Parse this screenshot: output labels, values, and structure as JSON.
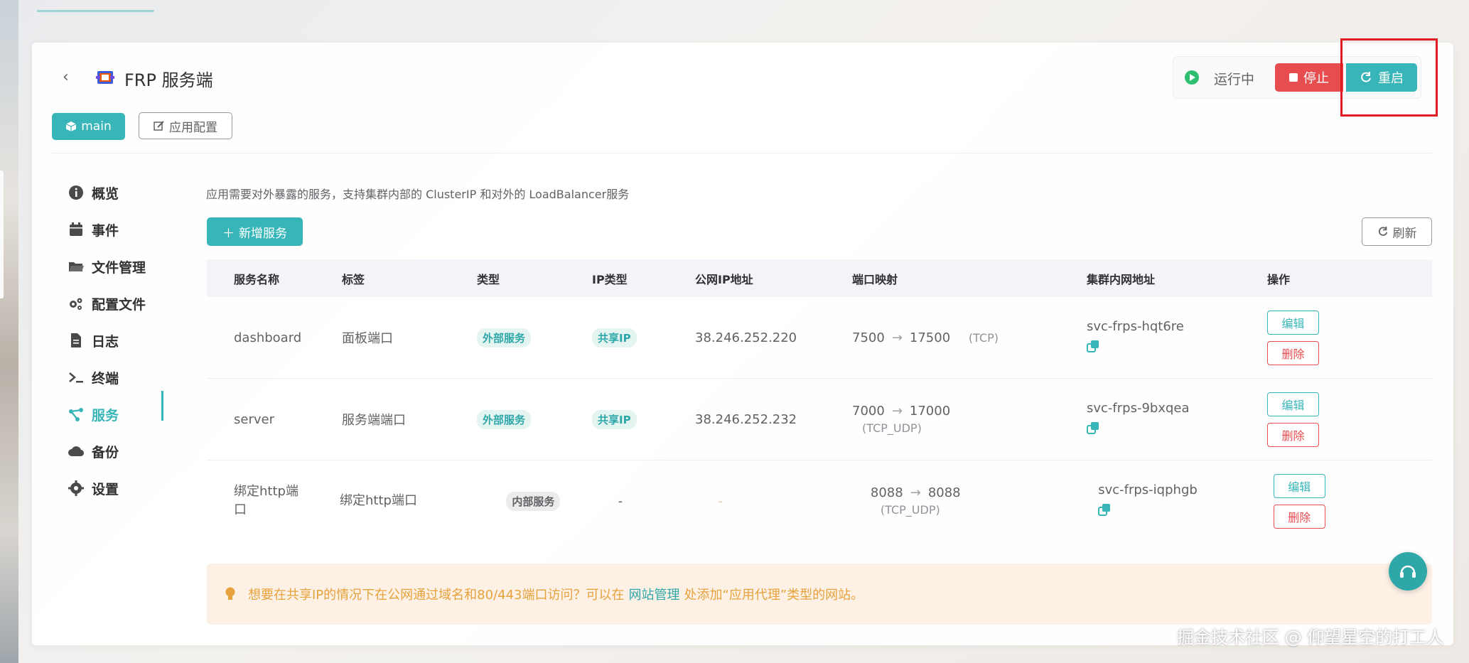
{
  "colors": {
    "accent": "#38b5b8",
    "danger": "#e74c4f",
    "running": "#2fbf71",
    "warning_text": "#e6a23c",
    "warning_bg": "#fdf1e6"
  },
  "header": {
    "title": "FRP 服务端",
    "logo_icon": "frp-logo-icon",
    "back_icon": "chevron-left-icon"
  },
  "status": {
    "text": "运行中",
    "stop_label": "停止",
    "restart_label": "重启"
  },
  "toolbar": {
    "tag_main": "main",
    "app_config_label": "应用配置"
  },
  "sidebar": {
    "items": [
      {
        "label": "概览",
        "icon": "info-icon"
      },
      {
        "label": "事件",
        "icon": "calendar-icon"
      },
      {
        "label": "文件管理",
        "icon": "folder-icon"
      },
      {
        "label": "配置文件",
        "icon": "gears-icon"
      },
      {
        "label": "日志",
        "icon": "file-icon"
      },
      {
        "label": "终端",
        "icon": "terminal-icon"
      },
      {
        "label": "服务",
        "icon": "share-icon",
        "active": true
      },
      {
        "label": "备份",
        "icon": "cloud-icon"
      },
      {
        "label": "设置",
        "icon": "gear-icon"
      }
    ]
  },
  "main": {
    "description": "应用需要对外暴露的服务，支持集群内部的 ClusterIP 和对外的 LoadBalancer服务",
    "add_label": "新增服务",
    "refresh_label": "刷新",
    "table": {
      "headers": [
        "服务名称",
        "标签",
        "类型",
        "IP类型",
        "公网IP地址",
        "端口映射",
        "集群内网地址",
        "操作"
      ],
      "rows": [
        {
          "name": "dashboard",
          "tag": "面板端口",
          "type": "外部服务",
          "ip_type": "共享IP",
          "public_ip": "38.246.252.220",
          "port_from": "7500",
          "port_to": "17500",
          "protocol": "(TCP)",
          "cluster_addr": "svc-frps-hqt6re",
          "edit": "编辑",
          "delete": "删除"
        },
        {
          "name": "server",
          "tag": "服务端端口",
          "type": "外部服务",
          "ip_type": "共享IP",
          "public_ip": "38.246.252.232",
          "port_from": "7000",
          "port_to": "17000",
          "protocol": "(TCP_UDP)",
          "cluster_addr": "svc-frps-9bxqea",
          "edit": "编辑",
          "delete": "删除"
        },
        {
          "name": "绑定http端口",
          "tag": "绑定http端口",
          "type": "内部服务",
          "ip_type": "-",
          "public_ip": "-",
          "port_from": "8088",
          "port_to": "8088",
          "protocol": "(TCP_UDP)",
          "cluster_addr": "svc-frps-iqphgb",
          "edit": "编辑",
          "delete": "删除"
        }
      ],
      "arrow": "→"
    },
    "tip": {
      "before": "想要在共享IP的情况下在公网通过域名和80/443端口访问？可以在",
      "link": "网站管理",
      "after": "处添加“应用代理”类型的网站。"
    }
  },
  "watermark": "掘金技术社区 @ 仰望星空的打工人"
}
